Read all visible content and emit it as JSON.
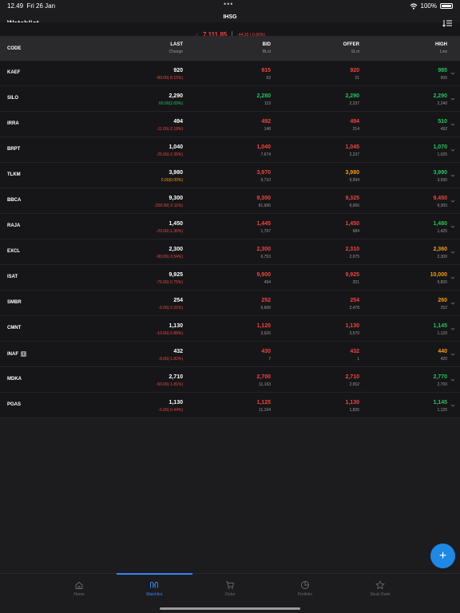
{
  "status": {
    "time": "12.49",
    "date": "Fri 26 Jan",
    "battery": "100%"
  },
  "header": {
    "title": "Watchlist",
    "index_name": "IHSG",
    "index_value": "7,111.85",
    "index_change": "-44.20 (-0.60%)"
  },
  "columns": {
    "code": "CODE",
    "last": "LAST",
    "last_sub": "Change",
    "bid": "BID",
    "bid_sub": "BLot",
    "offer": "OFFER",
    "offer_sub": "SLot",
    "high": "HIGH",
    "high_sub": "Low"
  },
  "rows": [
    {
      "code": "KAEF",
      "last": "920",
      "change": "-80.00(-8.15%)",
      "bid": "915",
      "blot": "63",
      "offer": "920",
      "slot": "21",
      "high": "985",
      "low": "905",
      "cc": "red",
      "bc": "red",
      "oc": "red",
      "hc": "green",
      "badge": ""
    },
    {
      "code": "SILO",
      "last": "2,290",
      "change": "60.00(2.69%)",
      "bid": "2,280",
      "blot": "119",
      "offer": "2,290",
      "slot": "2,237",
      "high": "2,290",
      "low": "2,240",
      "cc": "green",
      "bc": "green",
      "oc": "green",
      "hc": "green",
      "badge": ""
    },
    {
      "code": "IRRA",
      "last": "494",
      "change": "-11.00(-2.18%)",
      "bid": "492",
      "blot": "148",
      "offer": "494",
      "slot": "214",
      "high": "510",
      "low": "492",
      "cc": "red",
      "bc": "red",
      "oc": "red",
      "hc": "green",
      "badge": ""
    },
    {
      "code": "BRPT",
      "last": "1,040",
      "change": "-25.00(-2.35%)",
      "bid": "1,040",
      "blot": "7,674",
      "offer": "1,045",
      "slot": "2,237",
      "high": "1,070",
      "low": "1,025",
      "cc": "red",
      "bc": "red",
      "oc": "red",
      "hc": "green",
      "badge": ""
    },
    {
      "code": "TLKM",
      "last": "3,980",
      "change": "0.00(0.00%)",
      "bid": "3,970",
      "blot": "9,710",
      "offer": "3,980",
      "slot": "9,994",
      "high": "3,990",
      "low": "3,930",
      "cc": "orange",
      "bc": "red",
      "oc": "orange",
      "hc": "green",
      "badge": ""
    },
    {
      "code": "BBCA",
      "last": "9,300",
      "change": "-200.00(-2.11%)",
      "bid": "9,300",
      "blot": "81,995",
      "offer": "9,325",
      "slot": "9,956",
      "high": "9,450",
      "low": "9,300",
      "cc": "red",
      "bc": "red",
      "oc": "red",
      "hc": "red",
      "badge": ""
    },
    {
      "code": "RAJA",
      "last": "1,450",
      "change": "-20.00(-1.36%)",
      "bid": "1,445",
      "blot": "1,797",
      "offer": "1,450",
      "slot": "684",
      "high": "1,480",
      "low": "1,425",
      "cc": "red",
      "bc": "red",
      "oc": "red",
      "hc": "green",
      "badge": ""
    },
    {
      "code": "EXCL",
      "last": "2,300",
      "change": "-80.00(-3.54%)",
      "bid": "2,300",
      "blot": "6,753",
      "offer": "2,310",
      "slot": "2,075",
      "high": "2,360",
      "low": "2,300",
      "cc": "red",
      "bc": "red",
      "oc": "red",
      "hc": "orange",
      "badge": ""
    },
    {
      "code": "ISAT",
      "last": "9,925",
      "change": "-75.00(-0.75%)",
      "bid": "9,900",
      "blot": "494",
      "offer": "9,925",
      "slot": "201",
      "high": "10,000",
      "low": "9,800",
      "cc": "red",
      "bc": "red",
      "oc": "red",
      "hc": "orange",
      "badge": ""
    },
    {
      "code": "SMBR",
      "last": "254",
      "change": "-6.00(-2.31%)",
      "bid": "252",
      "blot": "6,666",
      "offer": "254",
      "slot": "2,478",
      "high": "260",
      "low": "252",
      "cc": "red",
      "bc": "red",
      "oc": "red",
      "hc": "orange",
      "badge": ""
    },
    {
      "code": "CMNT",
      "last": "1,130",
      "change": "-10.00(-0.88%)",
      "bid": "1,120",
      "blot": "3,626",
      "offer": "1,130",
      "slot": "3,570",
      "high": "1,145",
      "low": "1,120",
      "cc": "red",
      "bc": "red",
      "oc": "red",
      "hc": "green",
      "badge": ""
    },
    {
      "code": "INAF",
      "last": "432",
      "change": "-8.00(-1.82%)",
      "bid": "430",
      "blot": "7",
      "offer": "432",
      "slot": "1",
      "high": "440",
      "low": "420",
      "cc": "red",
      "bc": "red",
      "oc": "red",
      "hc": "orange",
      "badge": "i"
    },
    {
      "code": "MDKA",
      "last": "2,710",
      "change": "-50.00(-1.81%)",
      "bid": "2,700",
      "blot": "11,163",
      "offer": "2,710",
      "slot": "2,652",
      "high": "2,770",
      "low": "2,700",
      "cc": "red",
      "bc": "red",
      "oc": "red",
      "hc": "green",
      "badge": ""
    },
    {
      "code": "PGAS",
      "last": "1,130",
      "change": "-5.00(-0.44%)",
      "bid": "1,125",
      "blot": "11,104",
      "offer": "1,130",
      "slot": "1,835",
      "high": "1,145",
      "low": "1,125",
      "cc": "red",
      "bc": "red",
      "oc": "red",
      "hc": "green",
      "badge": ""
    }
  ],
  "tabs": [
    {
      "label": "Home",
      "icon": "home-icon"
    },
    {
      "label": "Watchlist",
      "icon": "watchlist-icon"
    },
    {
      "label": "Order",
      "icon": "cart-icon"
    },
    {
      "label": "Portfolio",
      "icon": "pie-icon"
    },
    {
      "label": "Stock Rank",
      "icon": "star-icon"
    }
  ],
  "active_tab": 1,
  "fab": "+"
}
